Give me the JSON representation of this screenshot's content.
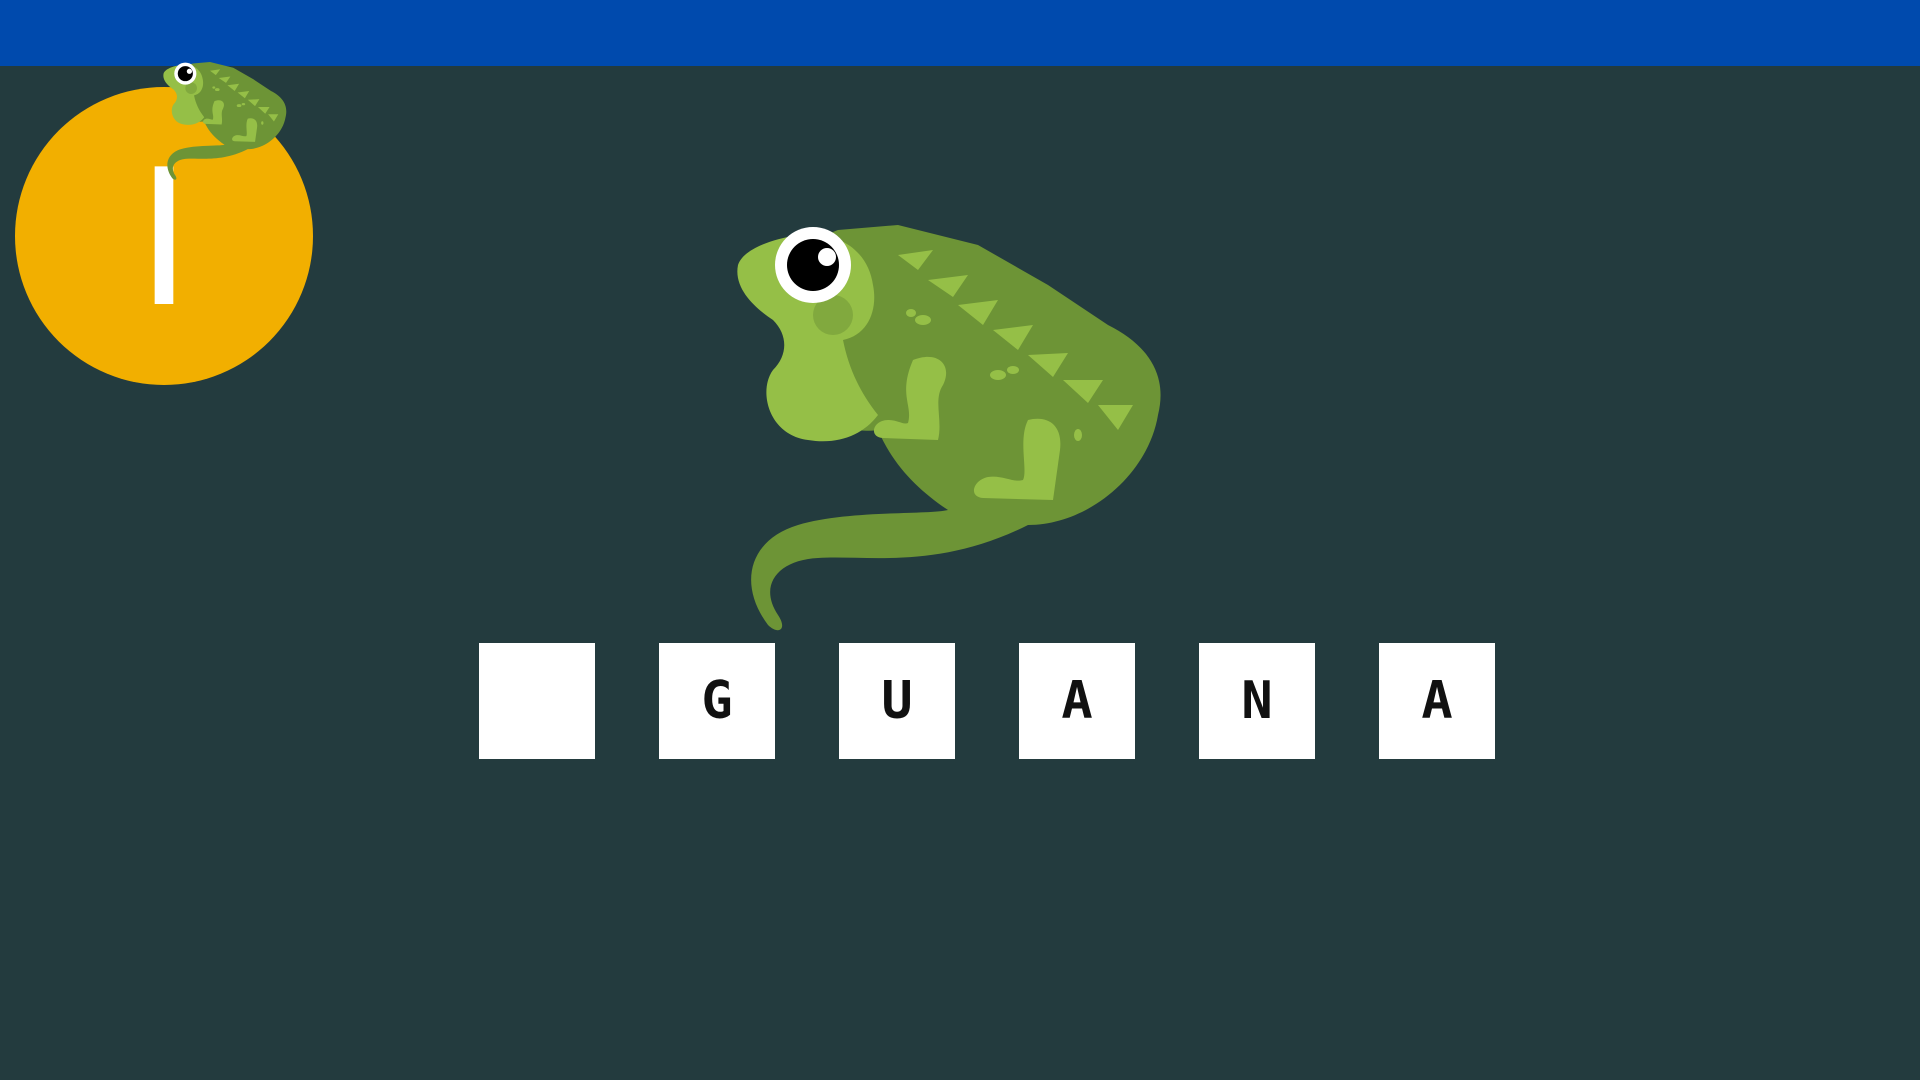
{
  "game": {
    "badge_letter": "I",
    "tiles": [
      {
        "letter": "",
        "state": "blank"
      },
      {
        "letter": "G",
        "state": "filled"
      },
      {
        "letter": "U",
        "state": "filled"
      },
      {
        "letter": "A",
        "state": "filled"
      },
      {
        "letter": "N",
        "state": "filled"
      },
      {
        "letter": "A",
        "state": "filled"
      }
    ]
  },
  "icons": {
    "badge_icon": "iguana-icon",
    "main_picture": "iguana-illustration"
  },
  "colors": {
    "background": "#233b3e",
    "top_bar": "#004aad",
    "badge": "#f2af00",
    "tile": "#ffffff",
    "iguana_light": "#95bf47",
    "iguana_dark": "#6d9436"
  }
}
